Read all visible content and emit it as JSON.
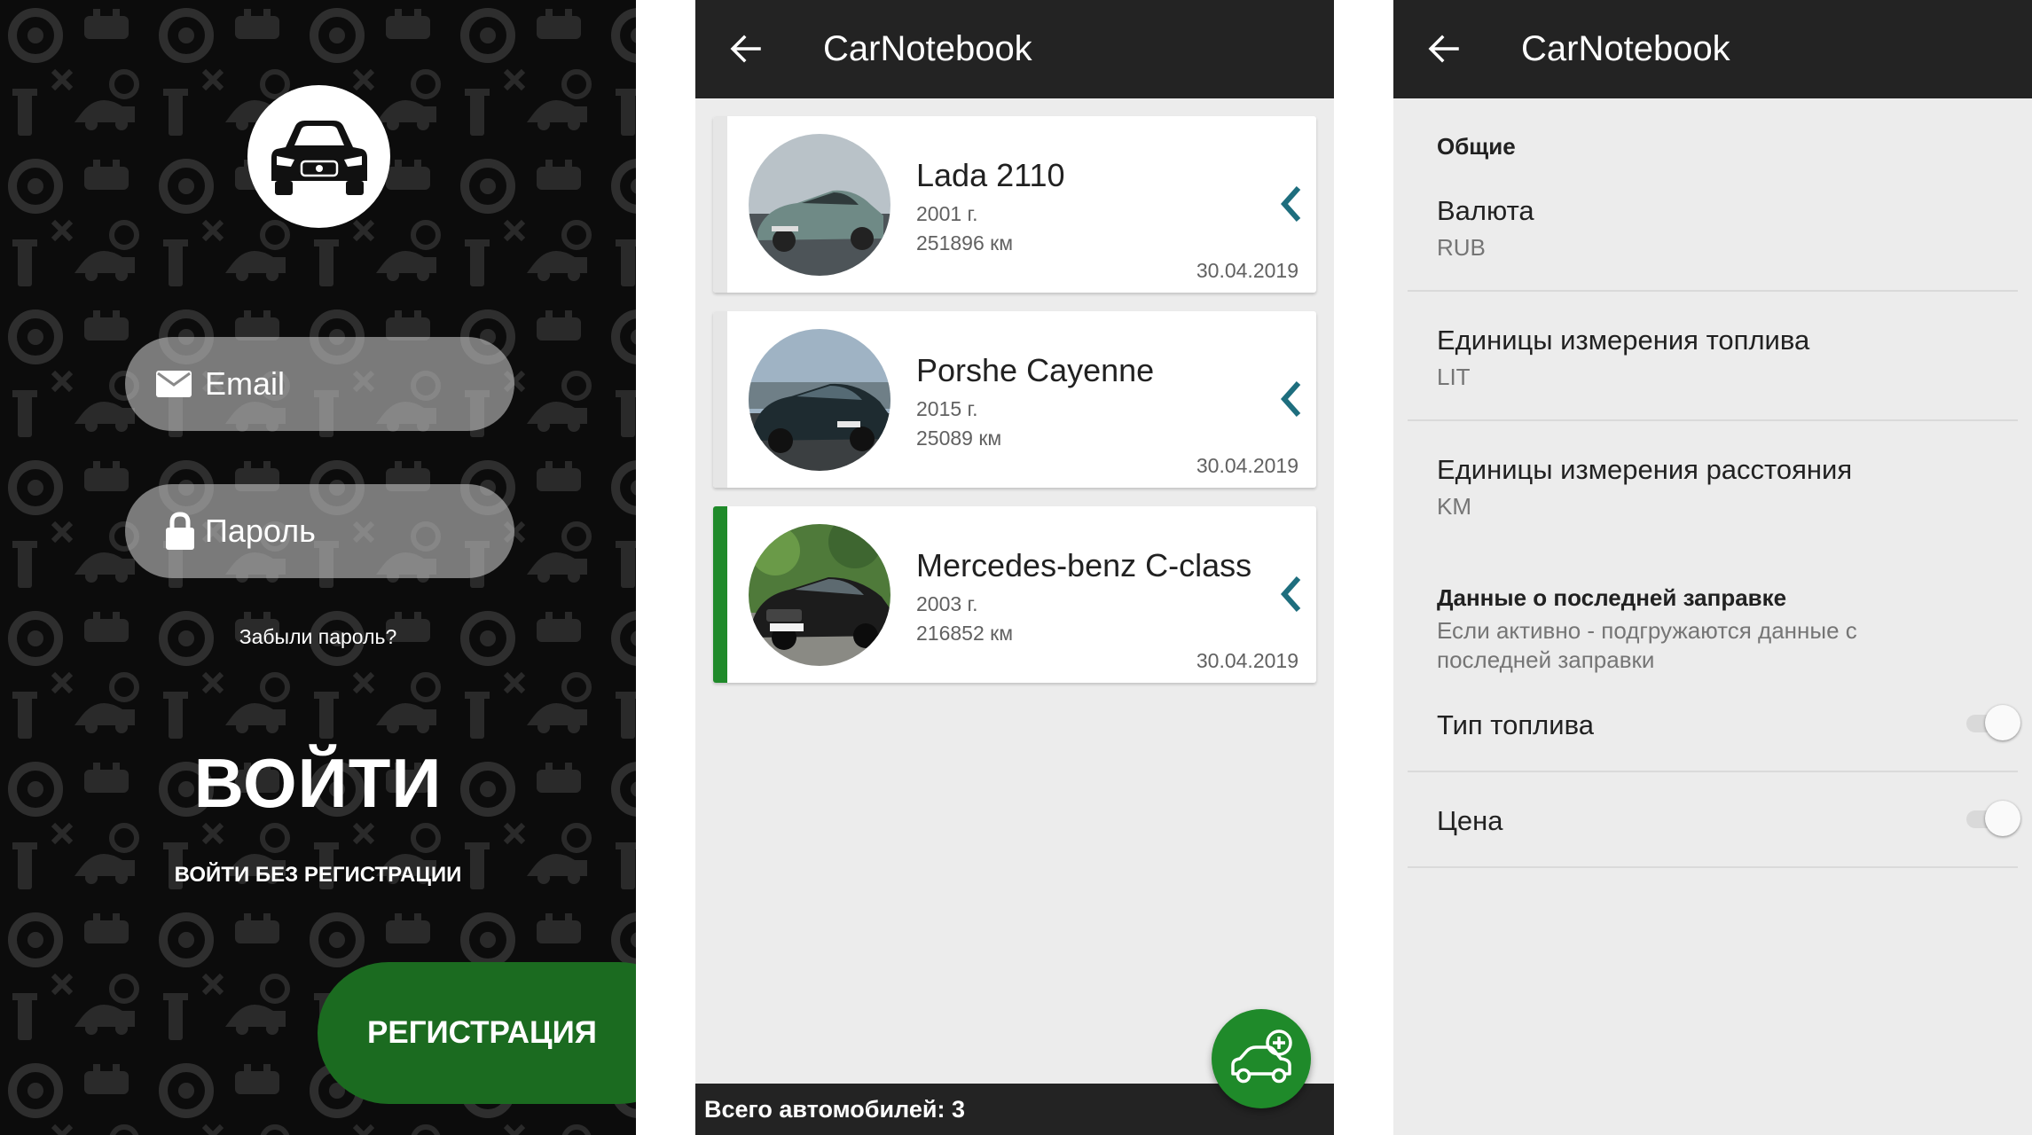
{
  "login": {
    "email_placeholder": "Email",
    "password_placeholder": "Пароль",
    "forgot_password": "Забыли пароль?",
    "login_button": "ВОЙТИ",
    "guest_login": "ВОЙТИ БЕЗ РЕГИСТРАЦИИ",
    "register_button": "РЕГИСТРАЦИЯ",
    "colors": {
      "background": "#0c0c0c",
      "register": "#1b6b20"
    }
  },
  "car_list": {
    "title": "CarNotebook",
    "cars": [
      {
        "name": "Lada 2110",
        "year": "2001 г.",
        "mileage": "251896 км",
        "date": "30.04.2019",
        "selected": false
      },
      {
        "name": "Porshe Cayenne",
        "year": "2015 г.",
        "mileage": "25089 км",
        "date": "30.04.2019",
        "selected": false
      },
      {
        "name": "Mercedes-benz C-class",
        "year": "2003 г.",
        "mileage": "216852 км",
        "date": "30.04.2019",
        "selected": true
      }
    ],
    "total": "Всего автомобилей: 3",
    "colors": {
      "accent": "#1f8a2a",
      "chevron": "#1e6e7e",
      "appbar": "#232323"
    }
  },
  "settings": {
    "title": "CarNotebook",
    "section_general": "Общие",
    "currency_title": "Валюта",
    "currency_value": "RUB",
    "fuel_units_title": "Единицы измерения топлива",
    "fuel_units_value": "LIT",
    "distance_units_title": "Единицы измерения расстояния",
    "distance_units_value": "KM",
    "section_last_refuel": "Данные о последней заправке",
    "last_refuel_desc": "Если активно - подгружаются данные с последней заправки",
    "fuel_type_label": "Тип топлива",
    "fuel_type_on": false,
    "price_label": "Цена",
    "price_on": false
  }
}
